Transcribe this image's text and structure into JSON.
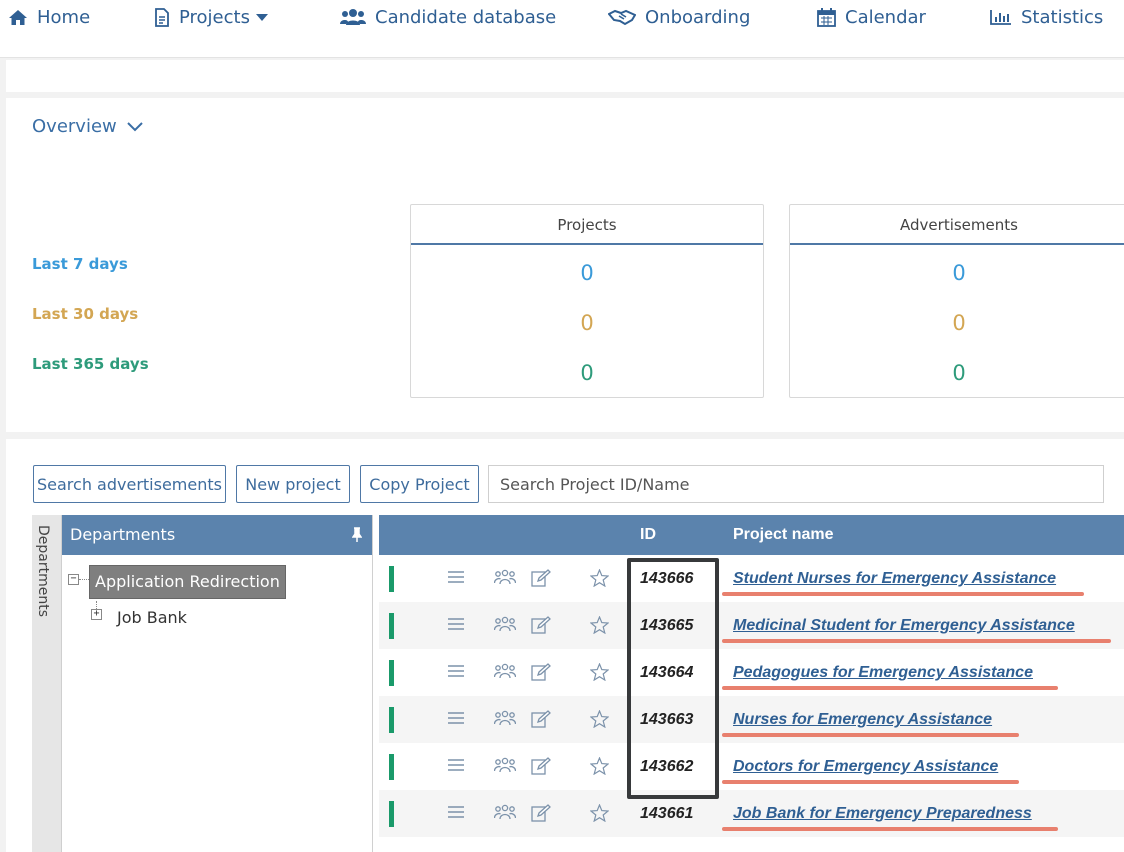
{
  "nav": {
    "home": "Home",
    "projects": "Projects",
    "candidate_database": "Candidate database",
    "onboarding": "Onboarding",
    "calendar": "Calendar",
    "statistics": "Statistics"
  },
  "overview": {
    "title": "Overview",
    "periods": {
      "last7": "Last 7 days",
      "last30": "Last 30 days",
      "last365": "Last 365 days"
    },
    "period_colors": {
      "last7": "#3a9ad9",
      "last30": "#d3a653",
      "last365": "#2e9b7b"
    },
    "projects": {
      "label": "Projects",
      "last7": "0",
      "last30": "0",
      "last365": "0"
    },
    "advertisements": {
      "label": "Advertisements",
      "last7": "0",
      "last30": "0",
      "last365": "0"
    }
  },
  "toolbar": {
    "search_advertisements": "Search advertisements",
    "new_project": "New project",
    "copy_project": "Copy Project",
    "search_placeholder": "Search Project ID/Name"
  },
  "departments": {
    "rail_label": "Departments",
    "header": "Departments",
    "selected": "Application Redirection",
    "child": "Job Bank"
  },
  "table": {
    "col_id": "ID",
    "col_name": "Project name",
    "rows": [
      {
        "id": "143666",
        "name": "Student Nurses for Emergency Assistance"
      },
      {
        "id": "143665",
        "name": "Medicinal Student for Emergency Assistance"
      },
      {
        "id": "143664",
        "name": "Pedagogues for Emergency Assistance"
      },
      {
        "id": "143663",
        "name": "Nurses for Emergency Assistance"
      },
      {
        "id": "143662",
        "name": "Doctors for Emergency Assistance"
      },
      {
        "id": "143661",
        "name": "Job Bank for Emergency Preparedness"
      }
    ]
  }
}
